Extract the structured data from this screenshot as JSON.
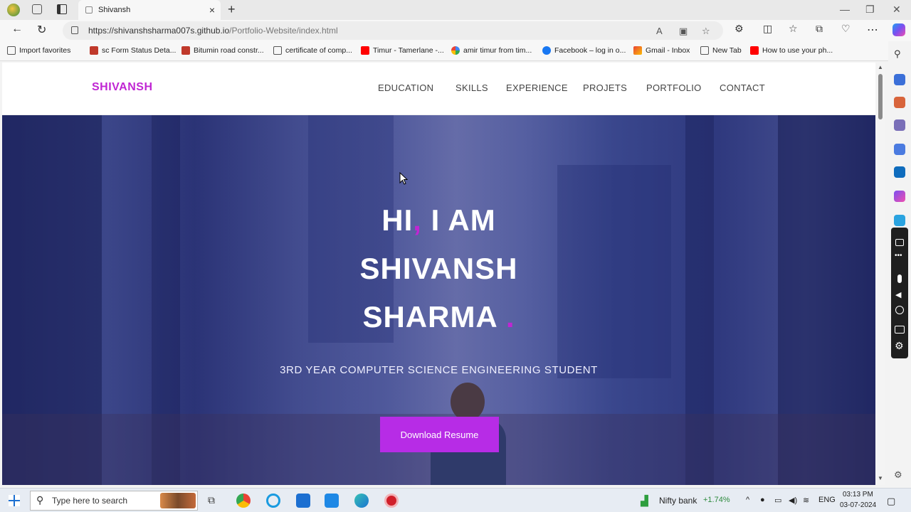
{
  "browser": {
    "tab_title": "Shivansh",
    "url_host": "https://shivanshsharma007s.github.io",
    "url_path": "/Portfolio-Website/index.html",
    "favorites": [
      "Import favorites",
      "sc Form Status Deta...",
      "Bitumin road constr...",
      "certificate of comp...",
      "Timur - Tamerlane -...",
      "amir timur from tim...",
      "Facebook – log in o...",
      "Gmail - Inbox",
      "New Tab",
      "How to use your ph..."
    ]
  },
  "site": {
    "brand": "SHIVANSH",
    "menu": [
      "EDUCATION",
      "SKILLS",
      "EXPERIENCE",
      "PROJETS",
      "PORTFOLIO",
      "CONTACT"
    ],
    "hero": {
      "line1_a": "HI",
      "line1_comma": ",",
      "line1_b": "I AM",
      "line2": "SHIVANSH",
      "line3": "SHARMA",
      "line3_dot": ".",
      "subtitle": "3RD YEAR COMPUTER SCIENCE ENGINEERING STUDENT",
      "button": "Download Resume"
    }
  },
  "taskbar": {
    "search_placeholder": "Type here to search",
    "ticker_name": "Nifty bank",
    "ticker_change": "+1.74%",
    "lang": "ENG",
    "time": "03:13 PM",
    "date": "03-07-2024"
  },
  "colors": {
    "accent": "#c026d3",
    "button": "#b72ce6",
    "hero_overlay": "#282d82"
  }
}
